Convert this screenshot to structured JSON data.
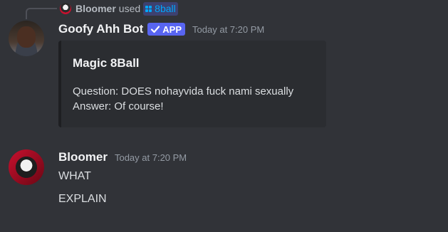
{
  "command_used": {
    "user": "Bloomer",
    "verb": "used",
    "command": "8ball",
    "icon": "slash-command-icon"
  },
  "bot_message": {
    "username": "Goofy Ahh Bot",
    "badge": "APP",
    "badge_icon": "checkmark-icon",
    "timestamp": "Today at 7:20 PM",
    "embed": {
      "title": "Magic 8Ball",
      "question": "Question: DOES nohayvida fuck nami sexually",
      "answer": "Answer: Of course!"
    }
  },
  "user_message": {
    "username": "Bloomer",
    "timestamp": "Today at 7:20 PM",
    "lines": [
      "WHAT",
      "EXPLAIN"
    ]
  },
  "colors": {
    "background": "#313338",
    "embed_background": "#2b2d31",
    "badge": "#5865f2",
    "command_link": "#00a8fc"
  }
}
